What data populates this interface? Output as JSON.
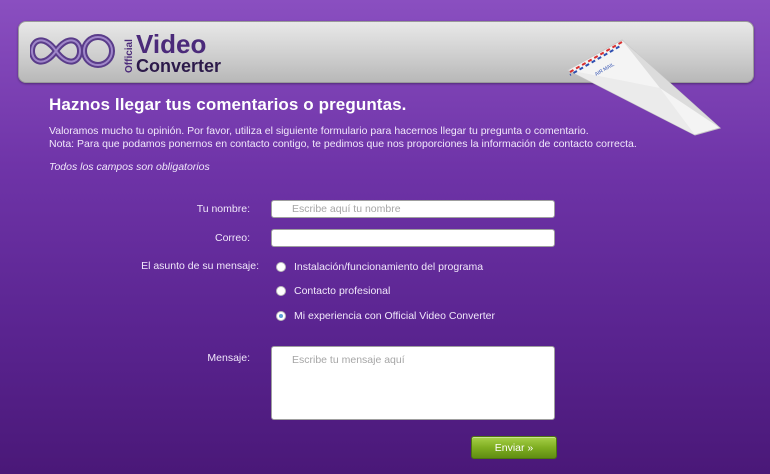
{
  "header": {
    "logo_official": "Official",
    "logo_video": "Video",
    "logo_converter": "Converter",
    "plane_stamp": "AIR MAIL"
  },
  "main": {
    "title": "Haznos llegar tus comentarios o preguntas.",
    "intro_line1": "Valoramos mucho tu opinión. Por favor, utiliza el siguiente formulario para hacernos llegar tu pregunta o comentario.",
    "intro_line2": "Nota: Para que podamos ponernos en contacto contigo, te pedimos que nos proporciones la información de contacto correcta.",
    "required_note": "Todos los campos son obligatorios"
  },
  "form": {
    "name_label": "Tu nombre:",
    "name_placeholder": "Escribe aquí tu nombre",
    "name_value": "",
    "email_label": "Correo:",
    "email_value": "",
    "subject_label": "El asunto de su mensaje:",
    "subject_options": [
      "Instalación/funcionamiento del programa",
      "Contacto profesional",
      "Mi experiencia con Official Video Converter"
    ],
    "subject_selected_index": 2,
    "message_label": "Mensaje:",
    "message_placeholder": "Escribe tu mensaje aquí",
    "message_value": "",
    "submit_label": "Enviar »"
  },
  "colors": {
    "background_top": "#8a4fc0",
    "background_bottom": "#4a1878",
    "logo_purple": "#4b2a7a",
    "button_green": "#7fae21",
    "radio_selected": "#5c9ed8"
  }
}
